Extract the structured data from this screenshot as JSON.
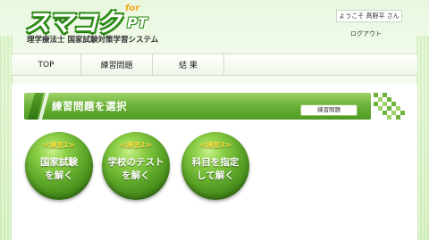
{
  "header": {
    "logo_main": "スマコク",
    "logo_for": "for",
    "logo_pt": "PT",
    "tagline": "理学療法士 国家試験対策学習システム",
    "welcome": "ようこそ 髙野平 さん",
    "logout": "ログアウト"
  },
  "nav": {
    "items": [
      {
        "label": "TOP"
      },
      {
        "label": "練習問題"
      },
      {
        "label": "結 果"
      }
    ]
  },
  "section": {
    "title": "練習問題を選択",
    "tag": "練習問題"
  },
  "practice": [
    {
      "badge": "≪練習1≫",
      "label": "国家試験\nを解く"
    },
    {
      "badge": "≪練習2≫",
      "label": "学校のテスト\nを解く"
    },
    {
      "badge": "≪練習3≫",
      "label": "科目を指定\nして解く"
    }
  ],
  "colors": {
    "brand_green": "#4e9a24",
    "accent_yellow": "#f5df3a",
    "logo_orange": "#f4a51b"
  }
}
